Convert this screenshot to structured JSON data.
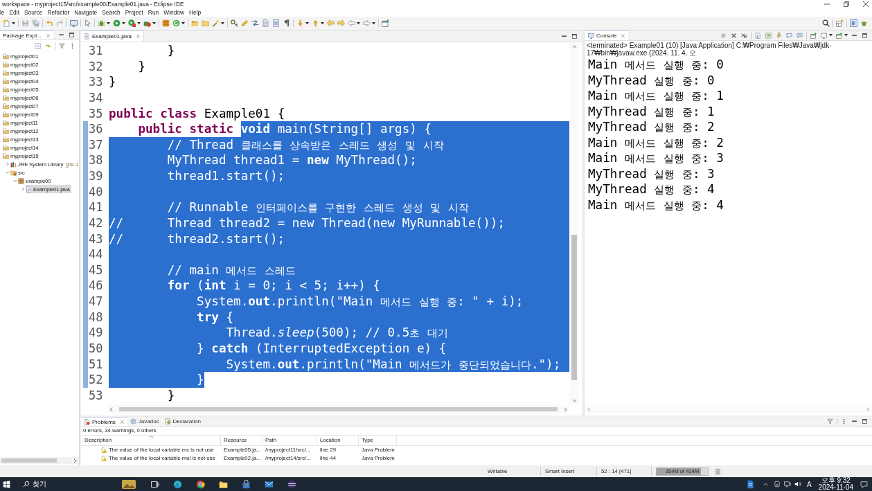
{
  "window": {
    "title": "workspace - myproject15/src/example00/Example01.java - Eclipse IDE"
  },
  "menu": [
    "le",
    "Edit",
    "Source",
    "Refactor",
    "Navigate",
    "Search",
    "Project",
    "Run",
    "Window",
    "Help"
  ],
  "package_explorer": {
    "tabs": [
      {
        "label": "Package Expl...",
        "selected": true
      }
    ],
    "items": [
      {
        "label": "myproject01",
        "kind": "project",
        "selected": false
      },
      {
        "label": "myproject02",
        "kind": "project",
        "selected": false
      },
      {
        "label": "myproject03",
        "kind": "project",
        "selected": false
      },
      {
        "label": "myproject04",
        "kind": "project",
        "selected": false
      },
      {
        "label": "myproject05",
        "kind": "project",
        "selected": false
      },
      {
        "label": "myproject06",
        "kind": "project",
        "selected": false
      },
      {
        "label": "myproject07",
        "kind": "project",
        "selected": false
      },
      {
        "label": "myproject09",
        "kind": "project",
        "selected": false
      },
      {
        "label": "myproject11",
        "kind": "project",
        "selected": false
      },
      {
        "label": "myproject12",
        "kind": "project",
        "selected": false
      },
      {
        "label": "myproject13",
        "kind": "project",
        "selected": false
      },
      {
        "label": "myproject14",
        "kind": "project",
        "selected": false
      },
      {
        "label": "myproject15",
        "kind": "project",
        "selected": false,
        "children": [
          {
            "label": "JRE System Library",
            "decoration": "[jdk-1",
            "kind": "library",
            "expanded": false,
            "selected": false
          },
          {
            "label": "src",
            "kind": "source_folder",
            "expanded": true,
            "selected": false,
            "children": [
              {
                "label": "example00",
                "kind": "package",
                "expanded": true,
                "selected": false,
                "children": [
                  {
                    "label": "Example01.java",
                    "kind": "java_file",
                    "expanded": false,
                    "selected": true
                  }
                ]
              }
            ]
          }
        ]
      }
    ]
  },
  "editor": {
    "tabs": [
      {
        "label": "Example01.java",
        "selected": true
      }
    ],
    "lines": [
      {
        "number": "31",
        "segments": [
          {
            "text": "        }",
            "selected": false
          }
        ],
        "eol_selected": false
      },
      {
        "number": "32",
        "segments": [
          {
            "text": "    }",
            "selected": false
          }
        ],
        "eol_selected": false
      },
      {
        "number": "33",
        "segments": [
          {
            "text": "}",
            "selected": false
          }
        ],
        "eol_selected": false
      },
      {
        "number": "34",
        "eol_selected": false
      },
      {
        "number": "35",
        "segments": [
          {
            "text": "**public class** Example01 {",
            "selected": false
          }
        ],
        "eol_selected": false
      },
      {
        "number": "36",
        "segments": [
          {
            "text": "    **public static** ",
            "selected": false
          },
          {
            "text": "**void** main(String[] args) {",
            "selected": true
          }
        ],
        "eol_selected": true
      },
      {
        "number": "37",
        "segments": [
          {
            "text": "        // Thread 클래스를 상속받은 스레드 생성 및 시작",
            "selected": true
          }
        ],
        "eol_selected": true
      },
      {
        "number": "38",
        "segments": [
          {
            "text": "        MyThread thread1 = **new** MyThread();",
            "selected": true
          }
        ],
        "eol_selected": true
      },
      {
        "number": "39",
        "segments": [
          {
            "text": "        thread1.start();",
            "selected": true
          }
        ],
        "eol_selected": true
      },
      {
        "number": "40",
        "eol_selected": true
      },
      {
        "number": "41",
        "segments": [
          {
            "text": "        // Runnable 인터페이스를 구현한 스레드 생성 및 시작",
            "selected": true
          }
        ],
        "eol_selected": true
      },
      {
        "number": "42",
        "segments": [
          {
            "text": "//      Thread thread2 = new Thread(new MyRunnable());",
            "selected": true
          }
        ],
        "eol_selected": true
      },
      {
        "number": "43",
        "segments": [
          {
            "text": "//      thread2.start();",
            "selected": true
          }
        ],
        "eol_selected": true
      },
      {
        "number": "44",
        "eol_selected": true
      },
      {
        "number": "45",
        "segments": [
          {
            "text": "        // main 메서드 스레드",
            "selected": true
          }
        ],
        "eol_selected": true
      },
      {
        "number": "46",
        "segments": [
          {
            "text": "        **for** (**int** i = 0; i < 5; i++) {",
            "selected": true
          }
        ],
        "eol_selected": true
      },
      {
        "number": "47",
        "segments": [
          {
            "text": "            System.**out**.println(\"Main 메서드 실행 중: \" + i);",
            "selected": true
          }
        ],
        "eol_selected": true
      },
      {
        "number": "48",
        "segments": [
          {
            "text": "            **try** {",
            "selected": true
          }
        ],
        "eol_selected": true
      },
      {
        "number": "49",
        "segments": [
          {
            "text": "                Thread.*sleep*(500); // 0.5초 대기",
            "selected": true
          }
        ],
        "eol_selected": true
      },
      {
        "number": "50",
        "segments": [
          {
            "text": "            } **catch** (InterruptedException e) {",
            "selected": true
          }
        ],
        "eol_selected": true
      },
      {
        "number": "51",
        "segments": [
          {
            "text": "                System.**out**.println(\"Main 메서드가 중단되었습니다.\");",
            "selected": true
          }
        ],
        "eol_selected": true
      },
      {
        "number": "52",
        "segments": [
          {
            "text": "            }",
            "selected": true
          }
        ],
        "eol_selected": false
      },
      {
        "number": "53",
        "segments": [
          {
            "text": "        }",
            "selected": false
          }
        ],
        "eol_selected": false
      }
    ]
  },
  "console": {
    "tabs": [
      {
        "label": "Console",
        "selected": true
      }
    ],
    "status": "<terminated> Example01 (10) [Java Application] C:₩Program Files₩Java₩jdk-17₩bin₩javaw.exe (2024. 11. 4. 오",
    "output": [
      "Main 메서드 실행 중: 0",
      "MyThread 실행 중: 0",
      "Main 메서드 실행 중: 1",
      "MyThread 실행 중: 1",
      "MyThread 실행 중: 2",
      "Main 메서드 실행 중: 2",
      "Main 메서드 실행 중: 3",
      "MyThread 실행 중: 3",
      "MyThread 실행 중: 4",
      "Main 메서드 실행 중: 4"
    ]
  },
  "problems": {
    "tabs": [
      {
        "label": "Problems",
        "kind": "problems",
        "selected": true
      },
      {
        "label": "Javadoc",
        "kind": "javadoc",
        "selected": false
      },
      {
        "label": "Declaration",
        "kind": "declaration",
        "selected": false
      }
    ],
    "summary": "0 errors, 34 warnings, 0 others",
    "columns": [
      "Description",
      "Resource",
      "Path",
      "Location",
      "Type"
    ],
    "rows": [
      [
        "The value of the local variable mc is not use",
        "Example05.ja...",
        "/myproject11/src/...",
        "line 29",
        "Java Problem"
      ],
      [
        "The value of the local variable mul is not use",
        "Example02.ja...",
        "/myproject14/src/...",
        "line 44",
        "Java Problem"
      ]
    ]
  },
  "status_bar": {
    "mode": "Writable",
    "insert_mode": "Smart Insert",
    "position": "52 : 14 [471]",
    "memory": {
      "label": "354M of 414M",
      "level": 0.86
    }
  },
  "taskbar": {
    "search_label": "찾기",
    "input_indicator": "A",
    "time": "오후 9:32",
    "date": "2024-11-04"
  }
}
